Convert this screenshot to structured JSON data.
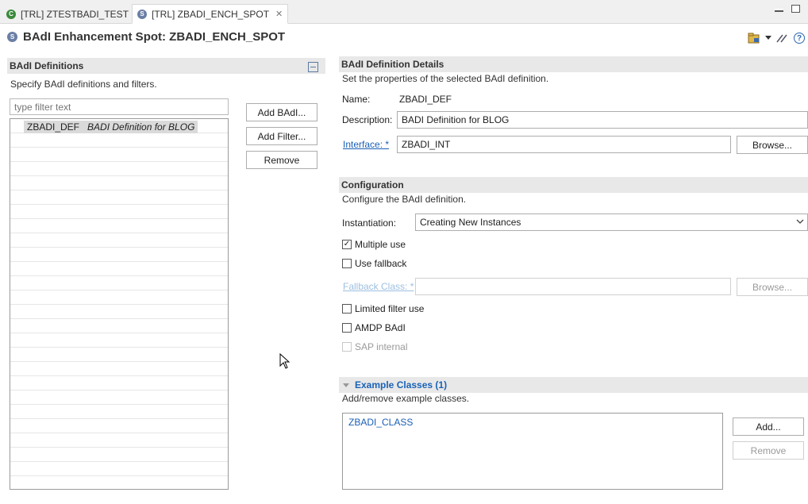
{
  "tabs": [
    {
      "label": "[TRL] ZTESTBADI_TEST",
      "icon": "class-icon",
      "icon_glyph": "C"
    },
    {
      "label": "[TRL] ZBADI_ENCH_SPOT",
      "icon": "spot-icon",
      "icon_glyph": "S",
      "close": "✕"
    }
  ],
  "editor": {
    "icon_glyph": "S",
    "title": "BAdI Enhancement Spot: ZBADI_ENCH_SPOT",
    "help": "?"
  },
  "left": {
    "section_title": "BAdI Definitions",
    "section_desc": "Specify BAdI definitions and filters.",
    "filter_placeholder": "type filter text",
    "tree_items": [
      {
        "name": "ZBADI_DEF",
        "description": "BADI Definition for BLOG"
      }
    ],
    "buttons": {
      "add_badi": "Add BAdI...",
      "add_filter": "Add Filter...",
      "remove": "Remove"
    }
  },
  "details": {
    "section_title": "BAdI Definition Details",
    "section_desc": "Set the properties of the selected BAdI definition.",
    "name_label": "Name:",
    "name_value": "ZBADI_DEF",
    "description_label": "Description:",
    "description_value": "BADI Definition for BLOG",
    "interface_label": "Interface: *",
    "interface_value": "ZBADI_INT",
    "browse": "Browse..."
  },
  "configuration": {
    "section_title": "Configuration",
    "section_desc": "Configure the BAdI definition.",
    "instantiation_label": "Instantiation:",
    "instantiation_value": "Creating New Instances",
    "multiple_use": {
      "label": "Multiple use",
      "checked": true
    },
    "use_fallback": {
      "label": "Use fallback",
      "checked": false
    },
    "fallback_label": "Fallback Class: *",
    "fallback_value": "",
    "fallback_browse": "Browse...",
    "limited_filter": {
      "label": "Limited filter use",
      "checked": false
    },
    "amdp_badi": {
      "label": "AMDP BAdI",
      "checked": false
    },
    "sap_internal": {
      "label": "SAP internal",
      "checked": false
    }
  },
  "examples": {
    "section_title": "Example Classes (1)",
    "section_desc": "Add/remove example classes.",
    "items": [
      "ZBADI_CLASS"
    ],
    "add": "Add...",
    "remove": "Remove"
  },
  "colors": {
    "link": "#1a5fb4",
    "section_bg": "#e8e8e8"
  }
}
